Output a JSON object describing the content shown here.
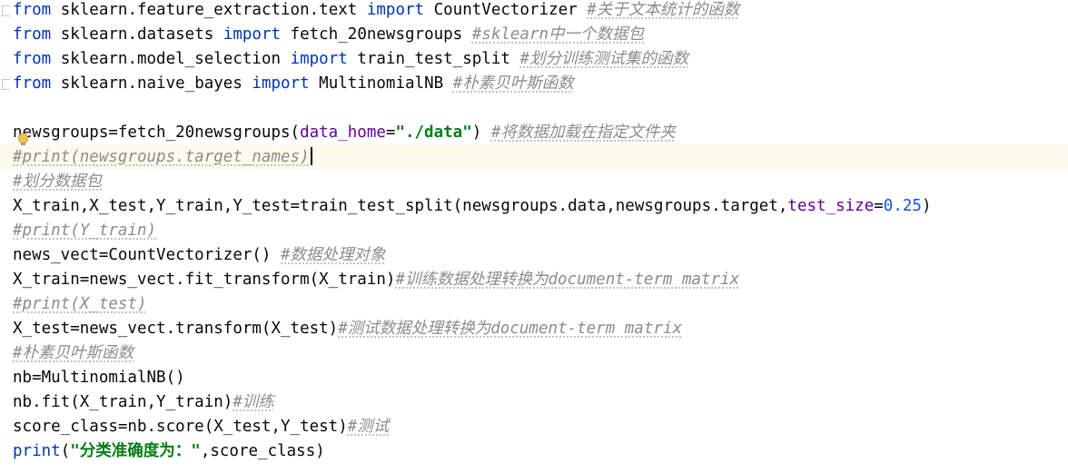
{
  "editor": {
    "lines": [
      [
        {
          "t": "from",
          "c": "kw"
        },
        {
          "t": " sklearn.feature_extraction.text ",
          "c": "plain"
        },
        {
          "t": "import",
          "c": "kw"
        },
        {
          "t": " CountVectorizer ",
          "c": "plain"
        },
        {
          "t": "#关于文本统计的函数",
          "c": "comment"
        }
      ],
      [
        {
          "t": "from",
          "c": "kw"
        },
        {
          "t": " sklearn.datasets ",
          "c": "plain"
        },
        {
          "t": "import",
          "c": "kw"
        },
        {
          "t": " fetch_20newsgroups ",
          "c": "plain"
        },
        {
          "t": "#sklearn中一个数据包",
          "c": "comment"
        }
      ],
      [
        {
          "t": "from",
          "c": "kw"
        },
        {
          "t": " sklearn.model_selection ",
          "c": "plain"
        },
        {
          "t": "import",
          "c": "kw"
        },
        {
          "t": " train_test_split ",
          "c": "plain"
        },
        {
          "t": "#划分训练测试集的函数",
          "c": "comment"
        }
      ],
      [
        {
          "t": "from",
          "c": "kw"
        },
        {
          "t": " sklearn.naive_bayes ",
          "c": "plain"
        },
        {
          "t": "import",
          "c": "kw"
        },
        {
          "t": " MultinomialNB ",
          "c": "plain"
        },
        {
          "t": "#朴素贝叶斯函数",
          "c": "comment"
        }
      ],
      [],
      [
        {
          "t": "newsgroups=fetch_20newsgroups(",
          "c": "plain"
        },
        {
          "t": "data_home",
          "c": "param"
        },
        {
          "t": "=",
          "c": "plain"
        },
        {
          "t": "\"./data\"",
          "c": "str"
        },
        {
          "t": ") ",
          "c": "plain"
        },
        {
          "t": "#将数据加载在指定文件夹",
          "c": "comment"
        }
      ],
      [
        {
          "t": "#print(newsgroups.target_names)",
          "c": "comment"
        }
      ],
      [
        {
          "t": "#划分数据包",
          "c": "comment"
        }
      ],
      [
        {
          "t": "X_train,X_test,Y_train,Y_test=train_test_split(newsgroups.data,newsgroups.target,",
          "c": "plain"
        },
        {
          "t": "test_size",
          "c": "param"
        },
        {
          "t": "=",
          "c": "plain"
        },
        {
          "t": "0.25",
          "c": "num"
        },
        {
          "t": ")",
          "c": "plain"
        }
      ],
      [
        {
          "t": "#print(Y_train)",
          "c": "comment"
        }
      ],
      [
        {
          "t": "news_vect=CountVectorizer() ",
          "c": "plain"
        },
        {
          "t": "#数据处理对象",
          "c": "comment"
        }
      ],
      [
        {
          "t": "X_train=news_vect.fit_transform(X_train)",
          "c": "plain"
        },
        {
          "t": "#训练数据处理转换为document-term matrix",
          "c": "comment"
        }
      ],
      [
        {
          "t": "#print(X_test)",
          "c": "comment"
        }
      ],
      [
        {
          "t": "X_test=news_vect.transform(X_test)",
          "c": "plain"
        },
        {
          "t": "#测试数据处理转换为document-term matrix",
          "c": "comment"
        }
      ],
      [
        {
          "t": "#朴素贝叶斯函数",
          "c": "comment"
        }
      ],
      [
        {
          "t": "nb=MultinomialNB()",
          "c": "plain"
        }
      ],
      [
        {
          "t": "nb.fit(X_train,Y_train)",
          "c": "plain"
        },
        {
          "t": "#训练",
          "c": "comment"
        }
      ],
      [
        {
          "t": "score_class=nb.score(X_test,Y_test)",
          "c": "plain"
        },
        {
          "t": "#测试",
          "c": "comment"
        }
      ],
      [
        {
          "t": "print",
          "c": "kw"
        },
        {
          "t": "(",
          "c": "plain"
        },
        {
          "t": "\"分类准确度为：\"",
          "c": "str"
        },
        {
          "t": ",score_class)",
          "c": "plain"
        }
      ]
    ],
    "current_line": 6,
    "intention_icon": "lightbulb-icon"
  },
  "colors": {
    "keyword": "#0033b3",
    "plain": "#080808",
    "parameter": "#660099",
    "string": "#067d17",
    "number": "#1750eb",
    "comment": "#8c8c8c",
    "current_line_bg": "#fcfaed"
  }
}
